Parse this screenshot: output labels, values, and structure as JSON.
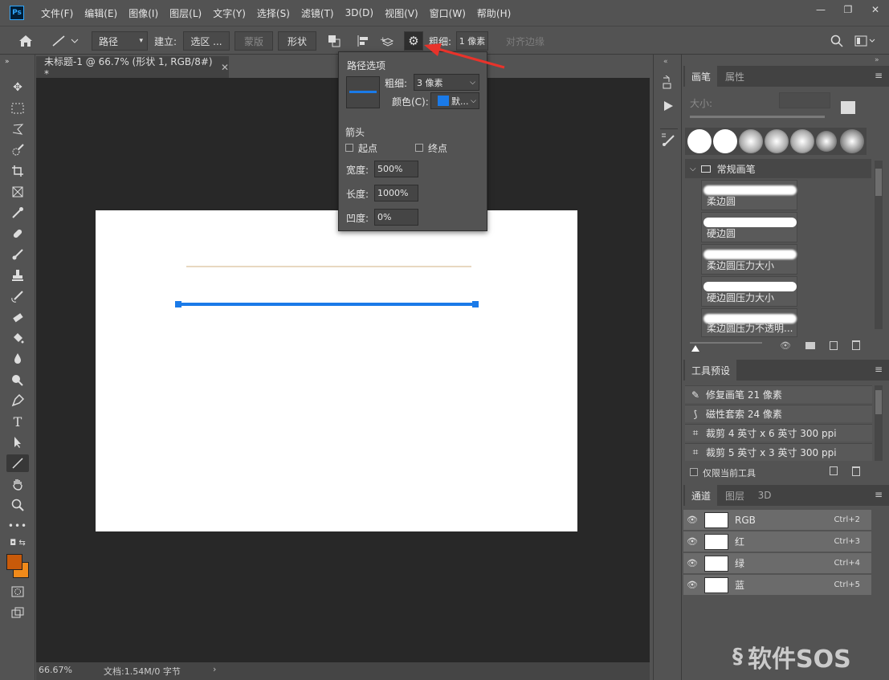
{
  "app": {
    "logo": "Ps"
  },
  "menu": [
    "文件(F)",
    "编辑(E)",
    "图像(I)",
    "图层(L)",
    "文字(Y)",
    "选择(S)",
    "滤镜(T)",
    "3D(D)",
    "视图(V)",
    "窗口(W)",
    "帮助(H)"
  ],
  "window_controls": [
    "—",
    "❐",
    "✕"
  ],
  "options": {
    "mode": "路径",
    "build_label": "建立:",
    "selection_btn": "选区 ...",
    "mask_btn": "蒙版",
    "shape_btn": "形状",
    "weight_label": "粗细:",
    "weight_value": "1 像素",
    "align_edges": "对齐边缘"
  },
  "document": {
    "tab_title": "未标题-1 @ 66.7% (形状 1, RGB/8#) *",
    "zoom": "66.67%",
    "doc_info": "文档:1.54M/0 字节"
  },
  "path_options": {
    "title": "路径选项",
    "weight_label": "粗细:",
    "weight_value": "3 像素",
    "color_label": "颜色(C):",
    "color_value": "默...",
    "color_swatch": "#1a7ae8",
    "arrow_title": "箭头",
    "start_label": "起点",
    "end_label": "终点",
    "width_label": "宽度:",
    "width_value": "500%",
    "length_label": "长度:",
    "length_value": "1000%",
    "concavity_label": "凹度:",
    "concavity_value": "0%"
  },
  "colors": {
    "foreground": "#c85a0a",
    "background": "#f08a1a",
    "path_line": "#1a7ae8",
    "guide_line": "#e8d8c0",
    "arrow_annotation": "#e8332b"
  },
  "brush_panel": {
    "tabs": [
      "画笔",
      "属性"
    ],
    "size_label": "大小:",
    "folder": "常规画笔",
    "brushes": [
      "柔边圆",
      "硬边圆",
      "柔边圆压力大小",
      "硬边圆压力大小",
      "柔边圆压力不透明..."
    ]
  },
  "tool_presets": {
    "title": "工具预设",
    "items": [
      "修复画笔 21 像素",
      "磁性套索 24 像素",
      "裁剪 4 英寸 x 6 英寸 300 ppi",
      "裁剪 5 英寸 x 3 英寸 300 ppi"
    ],
    "current_only": "仅限当前工具"
  },
  "channels": {
    "tabs": [
      "通道",
      "图层",
      "3D"
    ],
    "rows": [
      {
        "name": "RGB",
        "shortcut": "Ctrl+2"
      },
      {
        "name": "红",
        "shortcut": "Ctrl+3"
      },
      {
        "name": "绿",
        "shortcut": "Ctrl+4"
      },
      {
        "name": "蓝",
        "shortcut": "Ctrl+5"
      }
    ]
  },
  "watermark": "软件SOS"
}
